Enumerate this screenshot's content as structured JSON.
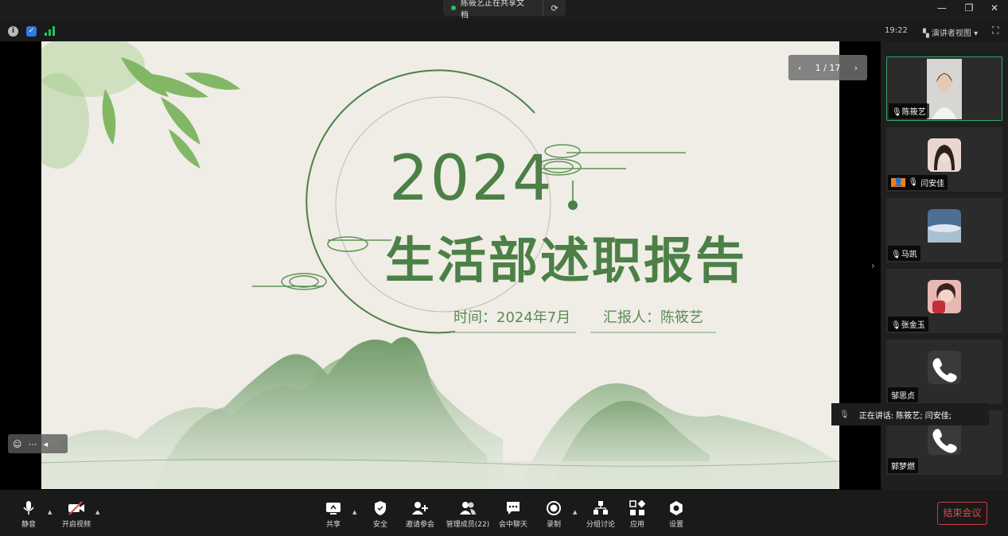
{
  "title_bar": {
    "sharing_status": "陈筱艺正在共享文档",
    "sync_icon": "sync-icon",
    "window_controls": [
      "minimize-icon",
      "restore-icon",
      "close-icon"
    ]
  },
  "status_bar": {
    "time": "19:22",
    "view_label": "演讲者视图",
    "view_caret": "▾",
    "signal_color": "#22c55e"
  },
  "slide": {
    "page_indicator": "1 / 17",
    "year": "2024",
    "title": "生活部述职报告",
    "time_line": "时间：2024年7月",
    "reporter_line": "汇报人：陈筱艺",
    "accent_color": "#4c8046"
  },
  "participants": [
    {
      "name": "陈筱艺",
      "active": true
    },
    {
      "name": "闫安佳",
      "active": false
    },
    {
      "name": "马凯",
      "active": false
    },
    {
      "name": "张金玉",
      "active": false
    },
    {
      "name": "邹思贞",
      "active": false
    },
    {
      "name": "郭梦燃",
      "active": false
    }
  ],
  "speaking": "正在讲话: 陈筱艺; 闫安佳;",
  "toolbar": {
    "mute": "静音",
    "video": "开启视频",
    "share": "共享",
    "security": "安全",
    "invite": "邀请参会",
    "manage": "管理成员(22)",
    "chat": "会中聊天",
    "record": "录制",
    "breakout": "分组讨论",
    "apps": "应用",
    "settings": "设置",
    "end": "结束会议",
    "end_color": "#d33b3b"
  }
}
